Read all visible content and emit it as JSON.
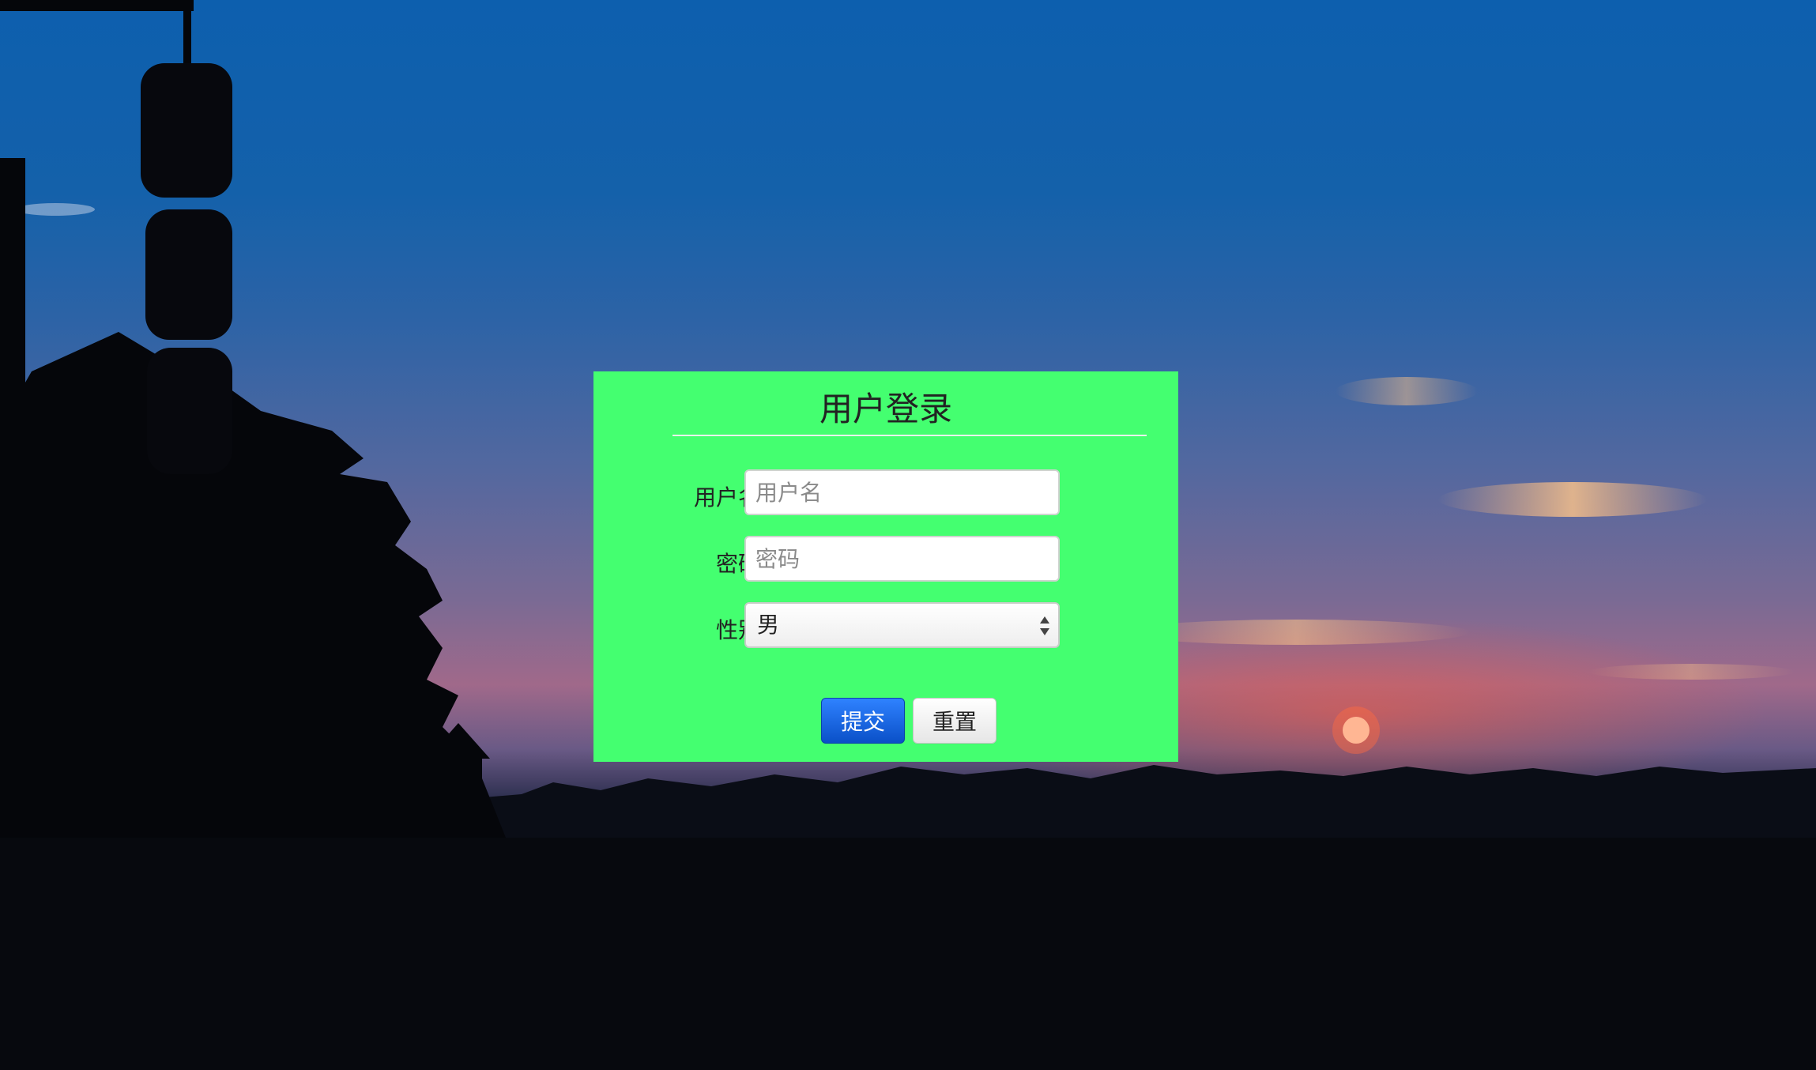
{
  "login": {
    "title": "用户登录",
    "username_label": "用户名",
    "username_placeholder": "用户名",
    "password_label": "密码",
    "password_placeholder": "密码",
    "gender_label": "性别",
    "gender_selected": "男",
    "submit_label": "提交",
    "reset_label": "重置"
  },
  "colors": {
    "panel_background": "#44ff70",
    "submit_button": "#0a50c8"
  },
  "icons": {
    "select_arrows": "up-down-arrows-icon"
  }
}
